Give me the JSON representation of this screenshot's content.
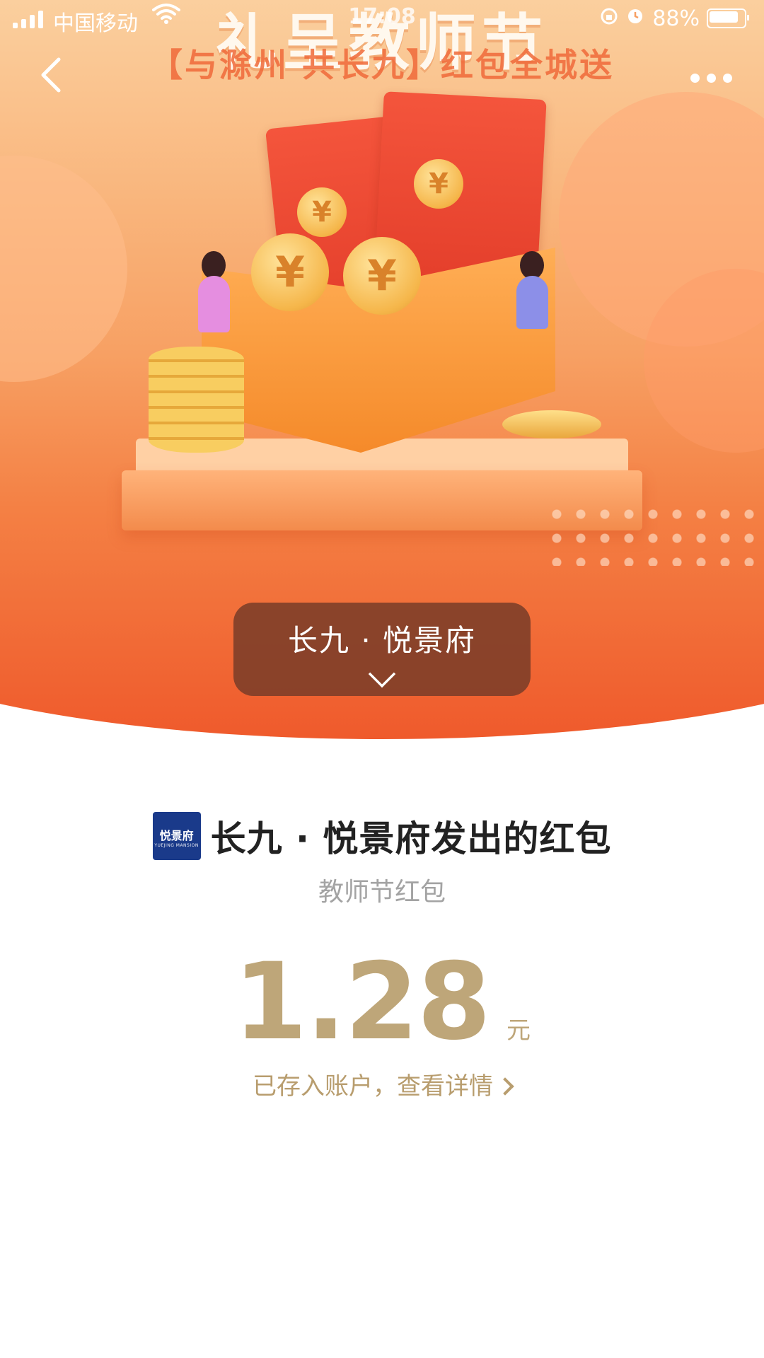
{
  "status_bar": {
    "carrier": "中国移动",
    "time": "17:08",
    "battery": "88%"
  },
  "banner": {
    "title": "礼呈教师节",
    "subtitle": "【与滁州 共长九】红包全城送",
    "coin_symbol": "¥"
  },
  "nav": {
    "back_icon": "chevron-left-icon",
    "more_icon": "more-dots-icon"
  },
  "sender_pill": {
    "label": "长九 · 悦景府"
  },
  "main": {
    "logo_text": "悦景府",
    "logo_sub": "YUEJING MANSION",
    "sender_title": "长九 · 悦景府发出的红包",
    "subtitle": "教师节红包",
    "amount": "1.28",
    "unit": "元",
    "detail_link": "已存入账户，查看详情"
  },
  "colors": {
    "amount": "#bea679",
    "pill_bg": "#783c28",
    "banner_top": "#fbd3a3",
    "banner_bottom": "#ef5a2c"
  }
}
